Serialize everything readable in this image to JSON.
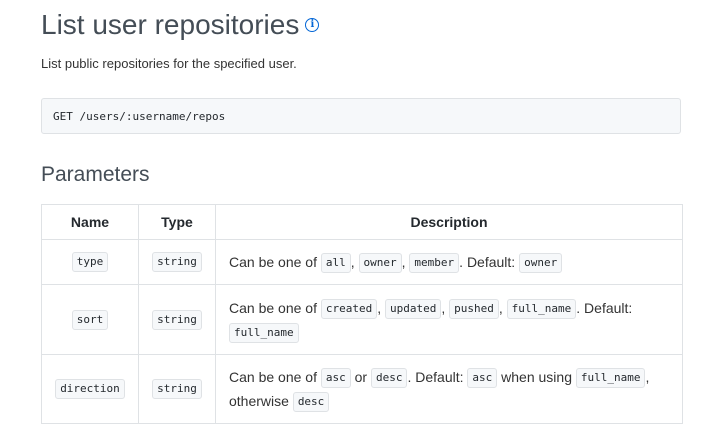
{
  "page": {
    "title": "List user repositories",
    "info_icon": "info-circle-icon",
    "intro": "List public repositories for the specified user.",
    "endpoint": "GET /users/:username/repos"
  },
  "parameters": {
    "heading": "Parameters",
    "headers": {
      "name": "Name",
      "type": "Type",
      "description": "Description"
    },
    "rows": [
      {
        "name": "type",
        "type": "string",
        "desc": {
          "p1": "Can be one of ",
          "c1": "all",
          "s1": ", ",
          "c2": "owner",
          "s2": ", ",
          "c3": "member",
          "p2": ". Default: ",
          "c4": "owner"
        }
      },
      {
        "name": "sort",
        "type": "string",
        "desc": {
          "p1": "Can be one of ",
          "c1": "created",
          "s1": ", ",
          "c2": "updated",
          "s2": ", ",
          "c3": "pushed",
          "s3": ", ",
          "c4": "full_name",
          "p2": ". Default: ",
          "c5": "full_name"
        }
      },
      {
        "name": "direction",
        "type": "string",
        "desc": {
          "p1": "Can be one of ",
          "c1": "asc",
          "s1": " or ",
          "c2": "desc",
          "p2": ". Default: ",
          "c3": "asc",
          "p3": " when using ",
          "c4": "full_name",
          "p4": ", otherwise ",
          "c5": "desc"
        }
      }
    ]
  }
}
